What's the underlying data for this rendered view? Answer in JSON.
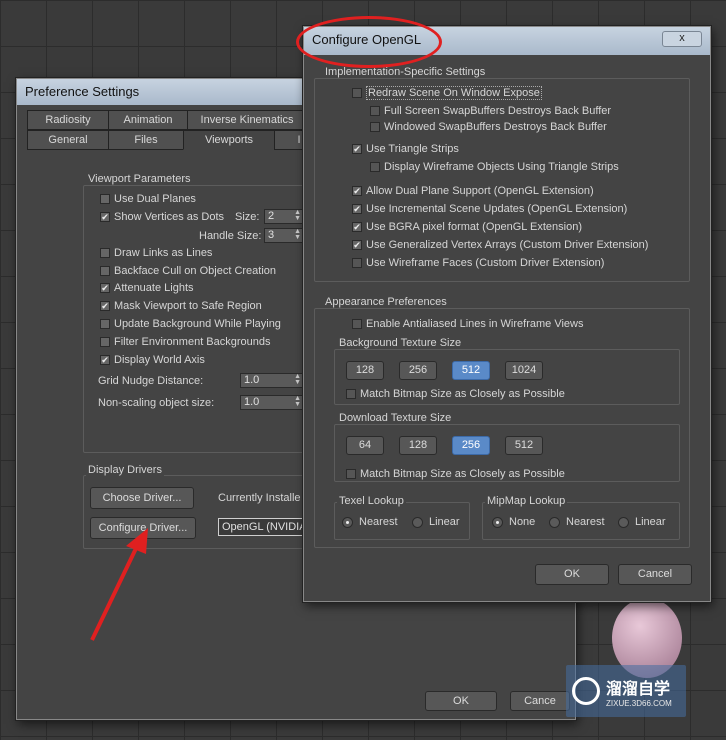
{
  "pref": {
    "title": "Preference Settings",
    "tabs_row1": [
      "Radiosity",
      "Animation",
      "Inverse Kinematics"
    ],
    "tabs_row2": [
      "General",
      "Files",
      "Viewports",
      "I"
    ],
    "viewport_params": {
      "label": "Viewport Parameters",
      "items": [
        {
          "label": "Use Dual Planes",
          "checked": false
        },
        {
          "label": "Show Vertices as Dots",
          "checked": true
        },
        {
          "label": "Draw Links as Lines",
          "checked": false
        },
        {
          "label": "Backface Cull on Object Creation",
          "checked": false
        },
        {
          "label": "Attenuate Lights",
          "checked": true
        },
        {
          "label": "Mask Viewport to Safe Region",
          "checked": true
        },
        {
          "label": "Update Background While Playing",
          "checked": false
        },
        {
          "label": "Filter Environment Backgrounds",
          "checked": false
        },
        {
          "label": "Display World Axis",
          "checked": true
        }
      ],
      "size_label": "Size:",
      "size_value": "2",
      "handle_size_label": "Handle Size:",
      "handle_size_value": "3",
      "grid_nudge_label": "Grid Nudge Distance:",
      "grid_nudge_value": "1.0",
      "nonscaling_label": "Non-scaling object size:",
      "nonscaling_value": "1.0"
    },
    "display_drivers": {
      "label": "Display Drivers",
      "choose_button": "Choose Driver...",
      "configure_button": "Configure Driver...",
      "currently_installed": "Currently Installe",
      "driver_value": "OpenGL (NVIDIA"
    },
    "ok": "OK",
    "cancel": "Cance"
  },
  "ogl": {
    "title": "Configure OpenGL",
    "close_glyph": "x",
    "impl": {
      "label": "Implementation-Specific Settings",
      "items": [
        {
          "label": "Redraw Scene On Window Expose",
          "checked": false
        },
        {
          "label": "Full Screen SwapBuffers Destroys Back Buffer",
          "checked": false
        },
        {
          "label": "Windowed SwapBuffers Destroys Back Buffer",
          "checked": false
        },
        {
          "label": "Use Triangle Strips",
          "checked": true
        },
        {
          "label": "Display Wireframe Objects Using Triangle Strips",
          "checked": false
        },
        {
          "label": "Allow Dual Plane Support (OpenGL Extension)",
          "checked": true
        },
        {
          "label": "Use Incremental Scene Updates (OpenGL Extension)",
          "checked": true
        },
        {
          "label": "Use BGRA pixel format (OpenGL Extension)",
          "checked": true
        },
        {
          "label": "Use Generalized Vertex Arrays (Custom Driver Extension)",
          "checked": true
        },
        {
          "label": "Use Wireframe Faces (Custom Driver Extension)",
          "checked": false
        }
      ]
    },
    "appearance": {
      "label": "Appearance Preferences",
      "antialiased": {
        "label": "Enable Antialiased Lines in Wireframe Views",
        "checked": false
      },
      "bg_texture": {
        "label": "Background Texture Size",
        "sizes": [
          "128",
          "256",
          "512",
          "1024"
        ],
        "selected": "512",
        "match": {
          "label": "Match Bitmap Size as Closely as Possible",
          "checked": false
        }
      },
      "dl_texture": {
        "label": "Download Texture Size",
        "sizes": [
          "64",
          "128",
          "256",
          "512"
        ],
        "selected": "256",
        "match": {
          "label": "Match Bitmap Size as Closely as Possible",
          "checked": false
        }
      },
      "texel": {
        "label": "Texel Lookup",
        "options": [
          "Nearest",
          "Linear"
        ],
        "selected": "Nearest"
      },
      "mipmap": {
        "label": "MipMap Lookup",
        "options": [
          "None",
          "Nearest",
          "Linear"
        ],
        "selected": "None"
      }
    },
    "ok": "OK",
    "cancel": "Cancel"
  },
  "watermark": {
    "brand": "溜溜自学",
    "url": "ZIXUE.3D66.COM"
  },
  "colors": {
    "annotation_red": "#e02020",
    "selected_blue": "#5a8ac8"
  }
}
